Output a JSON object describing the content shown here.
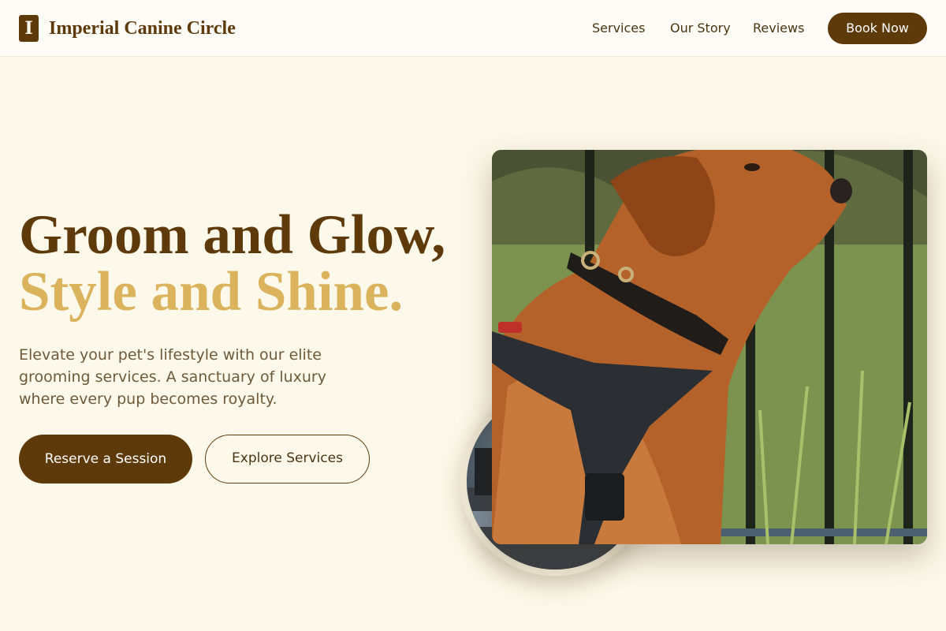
{
  "brand": {
    "logo_letter": "I",
    "name": "Imperial Canine Circle"
  },
  "nav": {
    "items": [
      {
        "label": "Services"
      },
      {
        "label": "Our Story"
      },
      {
        "label": "Reviews"
      }
    ],
    "cta_label": "Book Now"
  },
  "hero": {
    "headline_line1": "Groom and Glow,",
    "headline_line2": "Style and Shine.",
    "description": "Elevate your pet's lifestyle with our elite grooming services. A sanctuary of luxury where every pup becomes royalty.",
    "primary_button": "Reserve a Session",
    "secondary_button": "Explore Services"
  },
  "colors": {
    "background": "#fdf9ea",
    "brand_brown": "#5e3a0b",
    "accent_gold": "#dbb35c",
    "body_text": "#6e5a3a"
  }
}
